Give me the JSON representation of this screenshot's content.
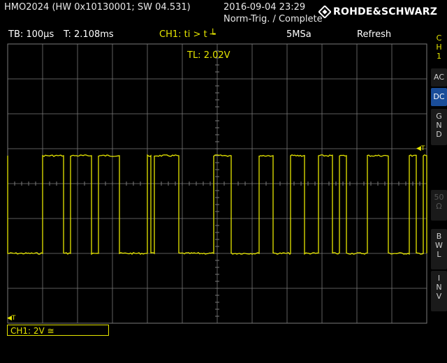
{
  "header": {
    "model": "HMO2024 (HW 0x10130001; SW 04.531)",
    "datetime": "2016-09-04 23:29",
    "status": "Norm-Trig. / Complete",
    "brand": "ROHDE&SCHWARZ",
    "brand_icon": "rs-diamond-logo-icon"
  },
  "infobar": {
    "timebase": "TB: 100µs",
    "trigger_time": "T: 2.108ms",
    "channel_trigger": "CH1: ti > t ┶",
    "sample_rate": "5MSa",
    "mode": "Refresh"
  },
  "screen": {
    "trigger_level": "TL:  2.02V",
    "ch_marker": "1",
    "trig_marker_left": "◀T",
    "trig_marker_right": "◀T",
    "grid_divisions": {
      "x": 12,
      "y": 8
    },
    "trace_color": "#e6e600",
    "grid_color": "#7a7a7a",
    "signal": {
      "high_level_div": 4.8,
      "low_level_div": 2.0,
      "transitions_div": [
        0.0,
        1.0,
        1.6,
        1.8,
        2.4,
        2.6,
        3.2,
        4.0,
        4.1,
        4.2,
        4.9,
        5.9,
        6.4,
        7.2,
        7.6,
        8.1,
        8.5,
        8.9,
        9.3,
        9.5,
        9.7,
        10.3,
        10.9,
        11.5,
        11.7,
        11.9
      ]
    }
  },
  "sidebar": {
    "channel": [
      "C",
      "H",
      "1"
    ],
    "ac": "AC",
    "dc": "DC",
    "gnd": [
      "G",
      "N",
      "D"
    ],
    "fifty": [
      "50",
      "Ω"
    ],
    "bwl": [
      "B",
      "W",
      "L"
    ],
    "inv": [
      "I",
      "N",
      "V"
    ]
  },
  "footer": {
    "channel_scale": "CH1: 2V ≅"
  }
}
